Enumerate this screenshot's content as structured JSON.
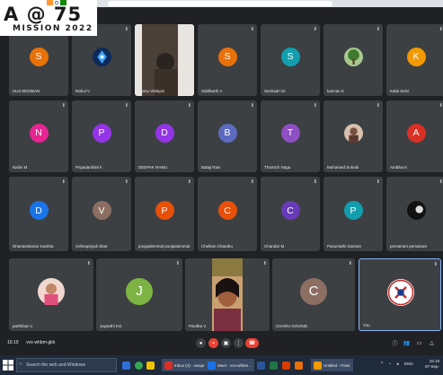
{
  "logo": {
    "line1": "A @ 75",
    "line2": "MISSION 2022"
  },
  "call": {
    "time": "15:19",
    "code": "vvx-whbm-gkk"
  },
  "participants": [
    {
      "name": "SUJI BOOBAN",
      "initial": "S",
      "color": "#e8710a",
      "kind": "avatar"
    },
    {
      "name": "Rahul V",
      "initial": "",
      "color": "#1a73e8",
      "kind": "photo-blue"
    },
    {
      "name": "Ramu Vettiyan",
      "initial": "",
      "color": "#5a5048",
      "kind": "photo-person"
    },
    {
      "name": "Siddharth A",
      "initial": "S",
      "color": "#e8710a",
      "kind": "avatar"
    },
    {
      "name": "Seshadri Gi",
      "initial": "S",
      "color": "#129eaf",
      "kind": "avatar"
    },
    {
      "name": "kannan K",
      "initial": "",
      "color": "#4a7a3a",
      "kind": "photo-tree"
    },
    {
      "name": "Kalai Selvi",
      "initial": "K",
      "color": "#f29900",
      "kind": "avatar"
    },
    {
      "name": "Nalini M",
      "initial": "N",
      "color": "#e52592",
      "kind": "avatar"
    },
    {
      "name": "Priyadarshini k",
      "initial": "P",
      "color": "#9334e6",
      "kind": "avatar"
    },
    {
      "name": "DEEPAK RAMU",
      "initial": "D",
      "color": "#9334e6",
      "kind": "avatar"
    },
    {
      "name": "Balaji Ravi",
      "initial": "B",
      "color": "#5c6bc0",
      "kind": "avatar"
    },
    {
      "name": "Thamizh Nagu",
      "initial": "T",
      "color": "#8e4fc4",
      "kind": "avatar"
    },
    {
      "name": "Mohamed Suhaib",
      "initial": "",
      "color": "#a07a6a",
      "kind": "photo-face"
    },
    {
      "name": "Ambika K",
      "initial": "A",
      "color": "#d93025",
      "kind": "avatar"
    },
    {
      "name": "Dhanasekaran Kavitha",
      "initial": "D",
      "color": "#1a73e8",
      "kind": "avatar"
    },
    {
      "name": "vishnupriyah bhat",
      "initial": "V",
      "color": "#8d6e63",
      "kind": "avatar"
    },
    {
      "name": "poojaalemmal poojaalemmal",
      "initial": "P",
      "color": "#e8500a",
      "kind": "avatar"
    },
    {
      "name": "Chellam Chandru",
      "initial": "C",
      "color": "#e8500a",
      "kind": "avatar"
    },
    {
      "name": "Chandar M",
      "initial": "C",
      "color": "#673ab7",
      "kind": "avatar"
    },
    {
      "name": "Pasumathi Kannan",
      "initial": "P",
      "color": "#129eaf",
      "kind": "avatar"
    },
    {
      "name": "pemairam pemairam",
      "initial": "",
      "color": "#222222",
      "kind": "photo-dark"
    },
    {
      "name": "parthiban v",
      "initial": "",
      "color": "#c06a80",
      "kind": "photo-girl"
    },
    {
      "name": "Jayanthi KG",
      "initial": "J",
      "color": "#7cb342",
      "kind": "avatar"
    },
    {
      "name": "Pavitha V",
      "initial": "",
      "color": "#a07050",
      "kind": "video-woman"
    },
    {
      "name": "CHARU GOVIND",
      "initial": "C",
      "color": "#8d6e63",
      "kind": "avatar"
    },
    {
      "name": "You",
      "initial": "",
      "color": "#ffffff",
      "kind": "you-logo"
    }
  ],
  "taskbar": {
    "search_placeholder": "Search the web and Windows",
    "apps": [
      {
        "label": "Inbox (4) - swapn...",
        "color": "#d93025"
      },
      {
        "label": "Meet - vvx-whbm...",
        "color": "#1a73e8"
      },
      {
        "label": "Untitled - Paint",
        "color": "#f29900"
      }
    ],
    "lang": "ENG",
    "clock_time": "15:19",
    "clock_date": "07-Sep-"
  },
  "colors": {
    "meet_bg": "#202124",
    "tile_bg": "#3c4043",
    "end_call": "#ea4335",
    "taskbar": "#1f2a3a"
  }
}
